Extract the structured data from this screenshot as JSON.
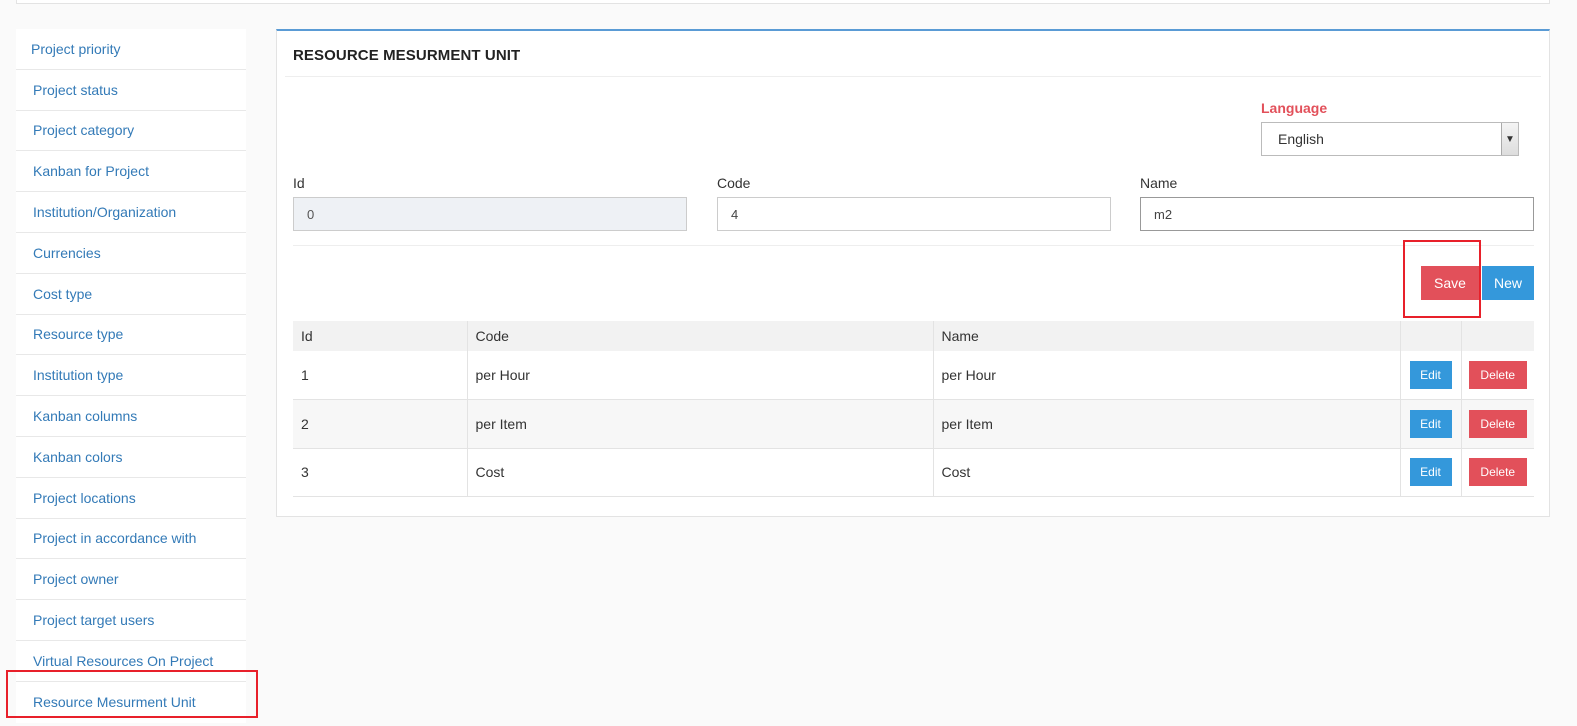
{
  "sidebar": {
    "items": [
      {
        "label": "Project priority"
      },
      {
        "label": "Project status"
      },
      {
        "label": "Project category"
      },
      {
        "label": "Kanban for Project"
      },
      {
        "label": "Institution/Organization"
      },
      {
        "label": "Currencies"
      },
      {
        "label": "Cost type"
      },
      {
        "label": "Resource type"
      },
      {
        "label": "Institution type"
      },
      {
        "label": "Kanban columns"
      },
      {
        "label": "Kanban colors"
      },
      {
        "label": "Project locations"
      },
      {
        "label": "Project in accordance with"
      },
      {
        "label": "Project owner"
      },
      {
        "label": "Project target users"
      },
      {
        "label": "Virtual Resources On Project"
      },
      {
        "label": "Resource Mesurment Unit"
      }
    ]
  },
  "panel": {
    "title": "RESOURCE MESURMENT UNIT",
    "language": {
      "label": "Language",
      "value": "English"
    },
    "form": {
      "id": {
        "label": "Id",
        "value": "0"
      },
      "code": {
        "label": "Code",
        "value": "4"
      },
      "name": {
        "label": "Name",
        "value": "m2"
      }
    },
    "buttons": {
      "save": "Save",
      "new": "New"
    },
    "table": {
      "headers": {
        "id": "Id",
        "code": "Code",
        "name": "Name"
      },
      "rows": [
        {
          "id": "1",
          "code": "per Hour",
          "name": "per Hour"
        },
        {
          "id": "2",
          "code": "per Item",
          "name": "per Item"
        },
        {
          "id": "3",
          "code": "Cost",
          "name": "Cost"
        }
      ],
      "edit_label": "Edit",
      "delete_label": "Delete"
    }
  },
  "colors": {
    "accent_blue": "#3498db",
    "accent_red": "#e2505a",
    "link": "#337ab7"
  }
}
